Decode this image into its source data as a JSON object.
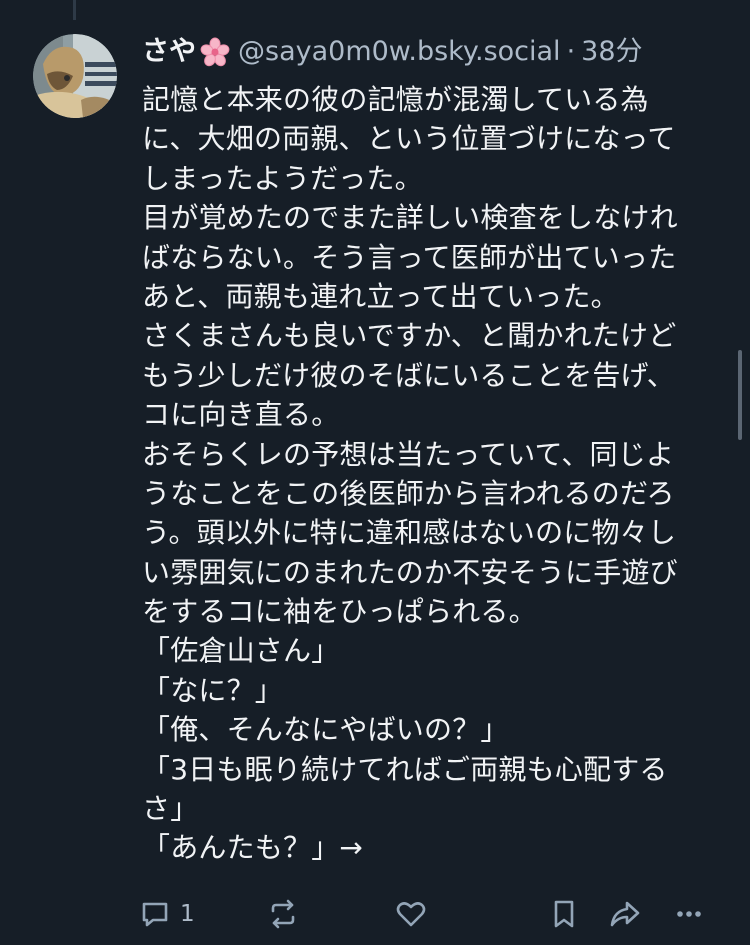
{
  "author": {
    "display_name": "さや",
    "emoji": "🌸",
    "handle": "@saya0m0w.bsky.social",
    "separator": "·",
    "time": "38分"
  },
  "post": {
    "lines": [
      "記憶と本来の彼の記憶が混濁している為",
      "に、大畑の両親、という位置づけになって",
      "しまったようだった。",
      "目が覚めたのでまた詳しい検査をしなけれ",
      "ばならない。そう言って医師が出ていった",
      "あと、両親も連れ立って出ていった。",
      "さくまさんも良いですか、と聞かれたけど",
      "もう少しだけ彼のそばにいることを告げ、",
      "コに向き直る。",
      "おそらくレの予想は当たっていて、同じよ",
      "うなことをこの後医師から言われるのだろ",
      "う。頭以外に特に違和感はないのに物々し",
      "い雰囲気にのまれたのか不安そうに手遊び",
      "をするコに袖をひっぱられる。",
      "「佐倉山さん」",
      "「なに？」",
      "「俺、そんなにやばいの？」",
      "「3日も眠り続けてればご両親も心配する",
      "さ」",
      "「あんたも？」→"
    ]
  },
  "actions": {
    "reply_icon": "reply-icon",
    "reply_count": "1",
    "repost_icon": "repost-icon",
    "like_icon": "heart-icon",
    "bookmark_icon": "bookmark-icon",
    "share_icon": "share-icon",
    "more_icon": "more-icon"
  },
  "colors": {
    "background": "#161e27",
    "text": "#f1f3f5",
    "muted": "#aebbc9",
    "icon": "#93a5b7"
  }
}
